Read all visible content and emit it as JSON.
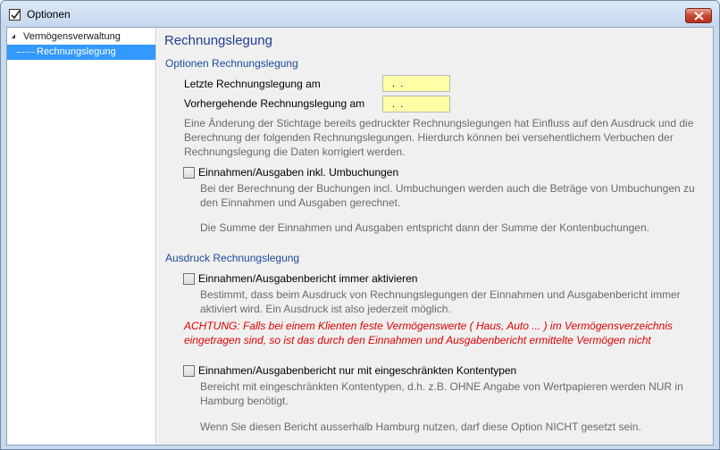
{
  "window": {
    "title": "Optionen",
    "icon": "checklist-icon",
    "close_icon": "close-icon"
  },
  "tree": {
    "root": {
      "label": "Vermögensverwaltung",
      "expanded": true
    },
    "child": {
      "label": "Rechnungslegung",
      "selected": true
    }
  },
  "page": {
    "title": "Rechnungslegung",
    "section1": {
      "title": "Optionen Rechnungslegung",
      "last_label": "Letzte Rechnungslegung am",
      "last_value": " .  .",
      "prev_label": "Vorhergehende Rechnungslegung am",
      "prev_value": " .  .",
      "info": "Eine Änderung der Stichtage bereits gedruckter Rechnungslegungen hat Einfluss auf den Ausdruck und die Berechnung der folgenden Rechnungslegungen. Hierdurch können bei versehentlichem Verbuchen der Rechnungslegung die Daten korrigiert werden.",
      "umbuchungen_label": "Einnahmen/Ausgaben inkl. Umbuchungen",
      "umbuchungen_checked": false,
      "umbuchungen_desc1": "Bei der Berechnung der Buchungen incl. Umbuchungen werden auch die Beträge von Umbuchungen zu den Einnahmen und Ausgaben gerechnet.",
      "umbuchungen_desc2": "Die Summe der Einnahmen und Ausgaben entspricht dann der Summe der Kontenbuchungen."
    },
    "section2": {
      "title": "Ausdruck Rechnungslegung",
      "always_label": "Einnahmen/Ausgabenbericht immer aktivieren",
      "always_checked": false,
      "always_desc": "Bestimmt, dass beim Ausdruck von Rechnungslegungen der Einnahmen und Ausgabenbericht immer aktiviert wird. Ein Ausdruck ist also jederzeit möglich.",
      "warning": "ACHTUNG: Falls bei einem Klienten feste Vermögenswerte ( Haus, Auto ... ) im Vermögensverzeichnis eingetragen sind, so ist das durch den Einnahmen und Ausgabenbericht ermittelte Vermögen nicht",
      "restricted_label": "Einnahmen/Ausgabenbericht nur mit eingeschränkten Kontentypen",
      "restricted_checked": false,
      "restricted_desc1": "Bereicht mit eingeschränkten Kontentypen, d.h. z.B. OHNE Angabe von Wertpapieren werden NUR in Hamburg benötigt.",
      "restricted_desc2": "Wenn Sie diesen Bericht ausserhalb Hamburg nutzen, darf diese Option NICHT gesetzt sein."
    }
  },
  "colors": {
    "accent": "#1e3f8f",
    "selection": "#3399ff",
    "warning": "#e00000",
    "input_bg": "#ffffa8"
  }
}
